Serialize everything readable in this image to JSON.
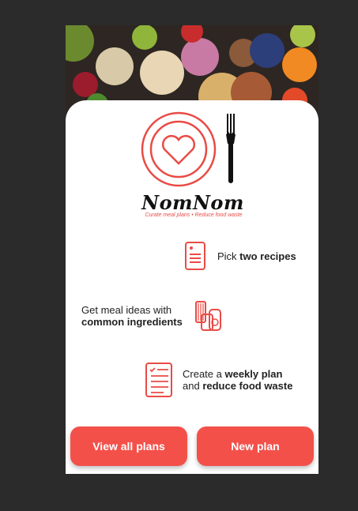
{
  "colors": {
    "accent": "#f4504a",
    "background": "#2b2b2b"
  },
  "brand": {
    "name": "NomNom",
    "tagline": "Curate meal plans • Reduce food waste"
  },
  "features": [
    {
      "icon": "recipe-card-icon",
      "prefix": "Pick ",
      "bold": "two recipes",
      "suffix": ""
    },
    {
      "icon": "ingredients-jars-icon",
      "line1": "Get meal ideas with",
      "bold": "common ingredients"
    },
    {
      "icon": "checklist-icon",
      "prefix": "Create a ",
      "bold": "weekly plan",
      "line2_prefix": "and ",
      "line2_bold": "reduce food waste"
    }
  ],
  "buttons": {
    "view_all": "View all plans",
    "new_plan": "New plan"
  }
}
